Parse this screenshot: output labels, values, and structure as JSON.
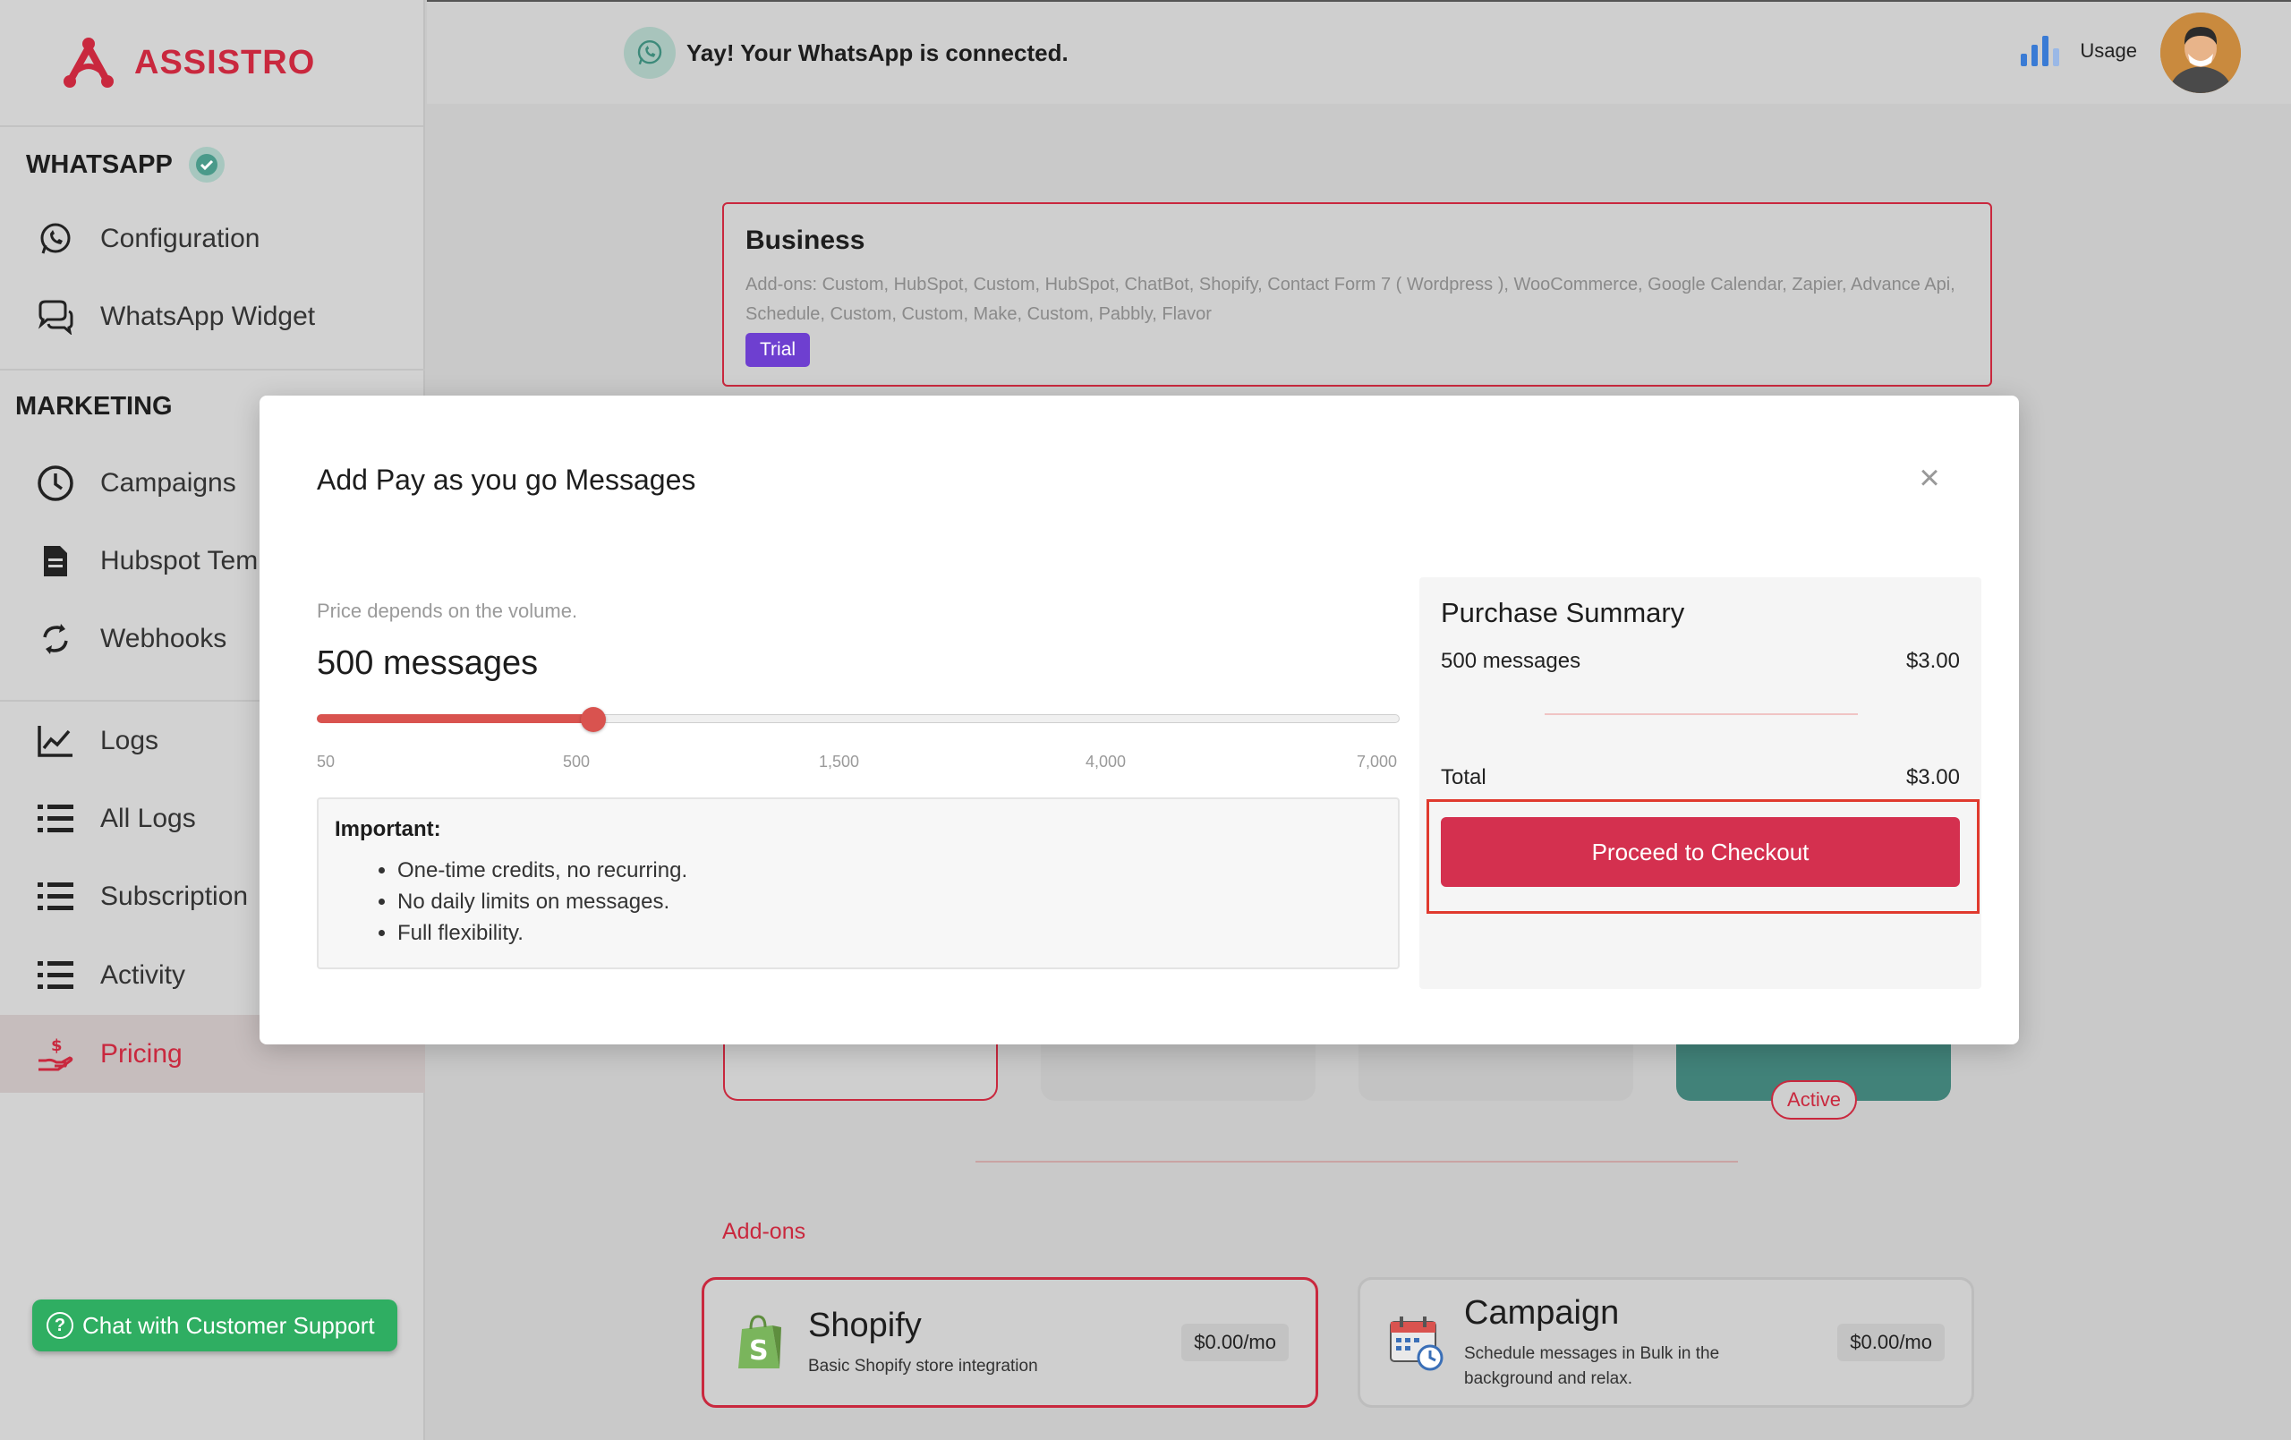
{
  "brand": {
    "name": "ASSISTRO"
  },
  "sidebar": {
    "whatsapp_title": "WHATSAPP",
    "marketing_title": "MARKETING",
    "whatsapp_items": [
      {
        "label": "Configuration",
        "icon": "whatsapp-icon"
      },
      {
        "label": "WhatsApp Widget",
        "icon": "chat-bubbles-icon"
      }
    ],
    "marketing_items": [
      {
        "label": "Campaigns",
        "icon": "clock-icon"
      },
      {
        "label": "Hubspot Tem",
        "icon": "document-icon"
      },
      {
        "label": "Webhooks",
        "icon": "refresh-icon"
      }
    ],
    "log_items": [
      {
        "label": "Logs",
        "icon": "line-chart-icon"
      },
      {
        "label": "All Logs",
        "icon": "list-icon"
      },
      {
        "label": "Subscription",
        "icon": "list-icon"
      },
      {
        "label": "Activity",
        "icon": "list-icon"
      },
      {
        "label": "Pricing",
        "icon": "hand-dollar-icon",
        "active": true
      }
    ],
    "support_label": "Chat with Customer Support"
  },
  "header": {
    "status_text": "Yay! Your WhatsApp is connected.",
    "usage_label": "Usage"
  },
  "plan": {
    "name": "Business",
    "addons_text": "Add-ons: Custom, HubSpot, Custom, HubSpot, ChatBot, Shopify, Contact Form 7 ( Wordpress ), WooCommerce, Google Calendar, Zapier, Advance Api, Schedule, Custom, Custom, Make, Custom, Pabbly, Flavor",
    "badge": "Trial"
  },
  "plan_tiles": {
    "active_label": "Active"
  },
  "addons": {
    "title": "Add-ons",
    "items": [
      {
        "name": "Shopify",
        "description": "Basic Shopify store integration",
        "price": "$0.00/mo",
        "icon": "shopify-bag-icon"
      },
      {
        "name": "Campaign",
        "description": "Schedule messages in Bulk in the background and relax.",
        "price": "$0.00/mo",
        "icon": "calendar-clock-icon"
      }
    ]
  },
  "modal": {
    "title": "Add Pay as you go Messages",
    "close_symbol": "×",
    "price_hint": "Price depends on the volume.",
    "selected_label": "500 messages",
    "slider": {
      "ticks": [
        "50",
        "500",
        "1,500",
        "4,000",
        "7,000"
      ],
      "selected_index": 1,
      "position_fraction": 0.255
    },
    "important_title": "Important:",
    "important_points": [
      "One-time credits, no recurring.",
      "No daily limits on messages.",
      "Full flexibility."
    ],
    "summary": {
      "title": "Purchase Summary",
      "line_label": "500 messages",
      "line_price": "$3.00",
      "total_label": "Total",
      "total_price": "$3.00",
      "checkout_label": "Proceed to Checkout"
    }
  },
  "colors": {
    "accent": "#c9283e",
    "checkout": "#d4304f",
    "slider": "#d9534f",
    "support": "#2fae62",
    "trial": "#6e3fd0",
    "active_plan": "#418279"
  }
}
